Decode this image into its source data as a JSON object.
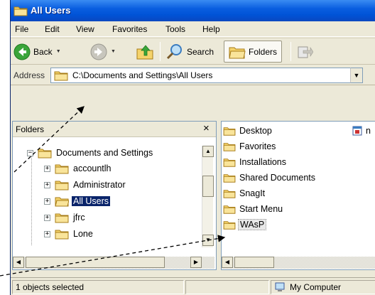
{
  "window": {
    "title": "All Users"
  },
  "menu": [
    "File",
    "Edit",
    "View",
    "Favorites",
    "Tools",
    "Help"
  ],
  "toolbar": {
    "back_label": "Back",
    "search_label": "Search",
    "folders_label": "Folders"
  },
  "address": {
    "label": "Address",
    "path": "C:\\Documents and Settings\\All Users"
  },
  "folders_pane": {
    "header": "Folders",
    "close": "×",
    "root": "Documents and Settings",
    "items": [
      "accountlh",
      "Administrator",
      "All Users",
      "jfrc",
      "Lone"
    ],
    "selected": "All Users"
  },
  "contents": {
    "items": [
      "Desktop",
      "Favorites",
      "Installations",
      "Shared Documents",
      "SnagIt",
      "Start Menu",
      "WAsP"
    ],
    "file_partial": "n"
  },
  "status": {
    "selection": "1 objects selected",
    "zone": "My Computer"
  },
  "colors": {
    "title_bar": "#0053d6",
    "selection": "#0a246a",
    "window_face": "#ece9d8"
  }
}
